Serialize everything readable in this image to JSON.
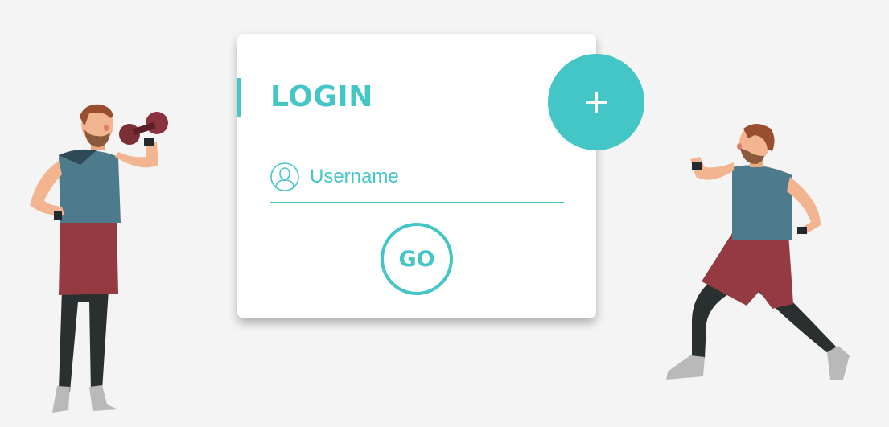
{
  "colors": {
    "accent": "#45c6c6",
    "background": "#f4f4f4",
    "card": "#ffffff"
  },
  "card": {
    "title": "LOGIN",
    "username": {
      "icon": "user-icon",
      "placeholder": "Username",
      "value": ""
    },
    "submit_label": "GO"
  },
  "add_button": {
    "icon": "plus-icon"
  },
  "illustrations": {
    "left": "man-lifting-dumbbell-illustration",
    "right": "man-flexing-walking-illustration"
  }
}
